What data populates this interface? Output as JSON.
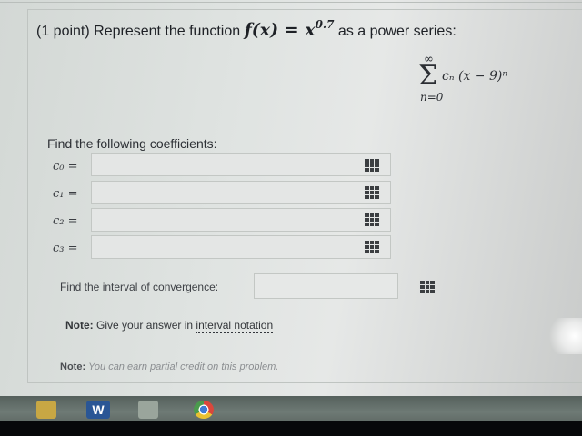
{
  "question": {
    "points": "(1 point)",
    "prompt": "Represent the function",
    "function": "f(x) = x",
    "exponent": "0.7",
    "suffix": "as a power series:"
  },
  "series": {
    "upper": "∞",
    "sigma": "Σ",
    "term": "cₙ (x − 9)ⁿ",
    "lower": "n=0"
  },
  "coefficients": {
    "heading": "Find the following coefficients:",
    "items": [
      {
        "label": "c₀ =",
        "value": ""
      },
      {
        "label": "c₁ =",
        "value": ""
      },
      {
        "label": "c₂ =",
        "value": ""
      },
      {
        "label": "c₃ =",
        "value": ""
      }
    ]
  },
  "interval": {
    "label": "Find the interval of convergence:",
    "value": ""
  },
  "note_interval": {
    "prefix": "Note:",
    "text": "Give your answer in",
    "link": "interval notation"
  },
  "note_partial": {
    "prefix": "Note:",
    "text": "You can earn partial credit on this problem."
  },
  "taskbar": {
    "word_icon_letter": "W"
  },
  "colors": {
    "background": "#dfe3e1",
    "taskbar": "#5f6a66",
    "keypad": "#3b3e41",
    "word": "#2a5695"
  },
  "icons": [
    "keypad-icon",
    "folder-icon",
    "word-icon",
    "excel-icon",
    "chrome-icon"
  ]
}
